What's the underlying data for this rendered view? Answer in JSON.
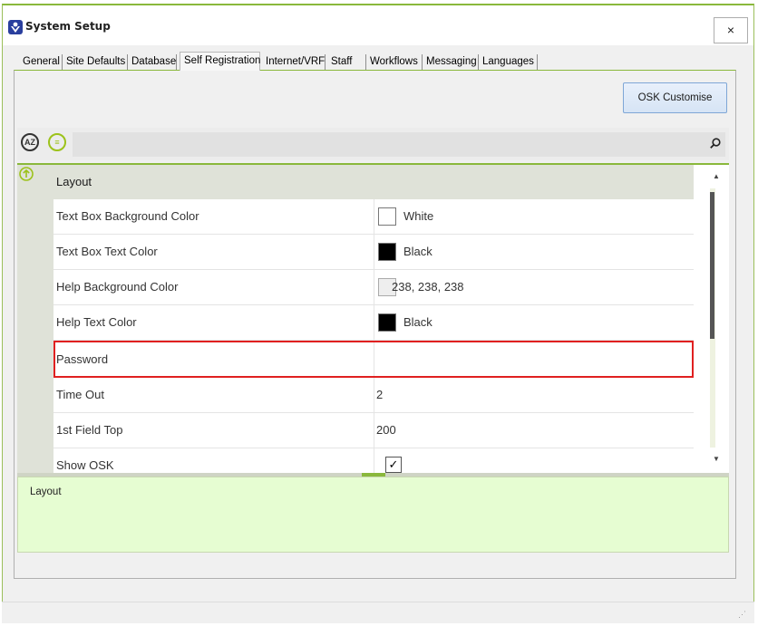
{
  "window": {
    "title": "System Setup",
    "close_label": "×"
  },
  "tabs": [
    {
      "label": "General"
    },
    {
      "label": "Site Defaults"
    },
    {
      "label": "Database"
    },
    {
      "label": "Self Registration"
    },
    {
      "label": "Internet/VRF"
    },
    {
      "label": "Staff"
    },
    {
      "label": "Workflows"
    },
    {
      "label": "Messaging"
    },
    {
      "label": "Languages"
    }
  ],
  "active_tab": "Self Registration",
  "toolbar": {
    "osk_button": "OSK Customise",
    "sort_alpha_glyph": "AZ",
    "sort_cat_glyph": "≡"
  },
  "grid": {
    "category": "Layout",
    "rows": [
      {
        "name": "Text Box Background Color",
        "value": "White",
        "swatch": "#ffffff"
      },
      {
        "name": "Text Box Text Color",
        "value": "Black",
        "swatch": "#000000"
      },
      {
        "name": "Help Background Color",
        "value": "238, 238, 238",
        "swatch": "#eeeeee"
      },
      {
        "name": "Help Text Color",
        "value": "Black",
        "swatch": "#000000"
      },
      {
        "name": "Password",
        "value": ""
      },
      {
        "name": "Time Out",
        "value": "2"
      },
      {
        "name": "1st Field Top",
        "value": "200"
      },
      {
        "name": "Show OSK",
        "value": "",
        "checked": true
      }
    ]
  },
  "help": {
    "title": "Layout"
  },
  "colors": {
    "accent": "#8ab83c",
    "selection_border": "#e02020",
    "help_bg": "#e6fdd2"
  }
}
